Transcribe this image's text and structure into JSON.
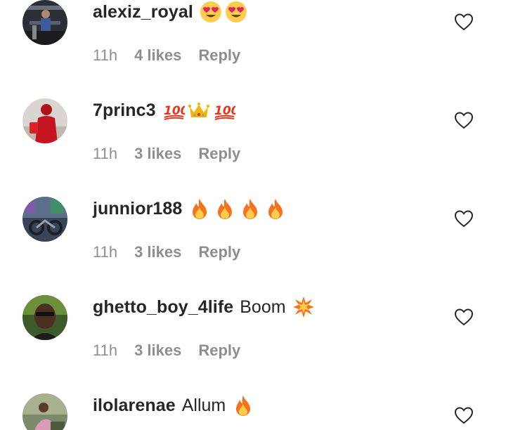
{
  "comments": [
    {
      "username": "alexiz_royal",
      "text": "",
      "emojis": [
        "heart-eyes-emoji",
        "heart-eyes-emoji"
      ],
      "time": "11h",
      "likes": "4 likes",
      "reply": "Reply"
    },
    {
      "username": "7princ3",
      "text": "",
      "emojis": [
        "hundred-emoji",
        "crown-emoji",
        "hundred-emoji"
      ],
      "time": "11h",
      "likes": "3 likes",
      "reply": "Reply"
    },
    {
      "username": "junnior188",
      "text": "",
      "emojis": [
        "fire-emoji",
        "fire-emoji",
        "fire-emoji",
        "fire-emoji"
      ],
      "time": "11h",
      "likes": "3 likes",
      "reply": "Reply"
    },
    {
      "username": "ghetto_boy_4life",
      "text": "Boom",
      "emojis": [
        "collision-emoji"
      ],
      "time": "11h",
      "likes": "3 likes",
      "reply": "Reply"
    },
    {
      "username": "ilolarenae",
      "text": "Allum",
      "emojis": [
        "fire-emoji"
      ],
      "time": "",
      "likes": "",
      "reply": ""
    }
  ],
  "colors": {
    "text": "#262626",
    "meta": "#8e8e8e",
    "background": "#ffffff"
  }
}
